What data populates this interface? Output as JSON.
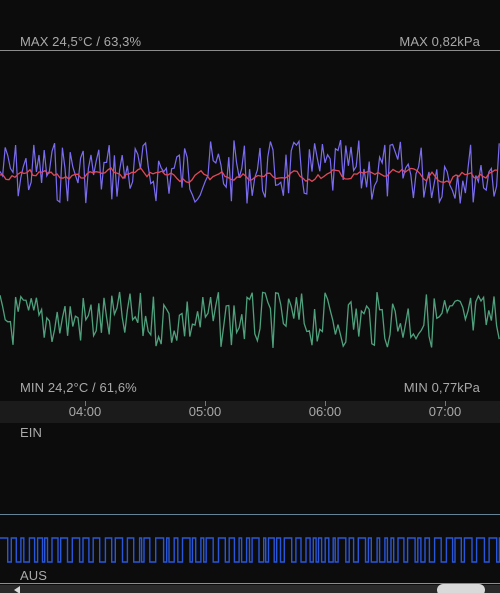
{
  "climate": {
    "max_temp_hum": "MAX 24,5°C / 63,3%",
    "max_pressure": "MAX 0,82kPa",
    "min_temp_hum": "MIN 24,2°C / 61,6%",
    "min_pressure": "MIN 0,77kPa"
  },
  "timeline": {
    "ticks": [
      "04:00",
      "05:00",
      "06:00",
      "07:00"
    ]
  },
  "switch": {
    "on_label": "EIN",
    "off_label": "AUS"
  },
  "colors": {
    "temperature": "#7a6cf0",
    "pressure": "#e0485a",
    "humidity": "#4fa07c",
    "switch_state": "#2a56d8",
    "gridline": "#8d8d8d"
  }
}
